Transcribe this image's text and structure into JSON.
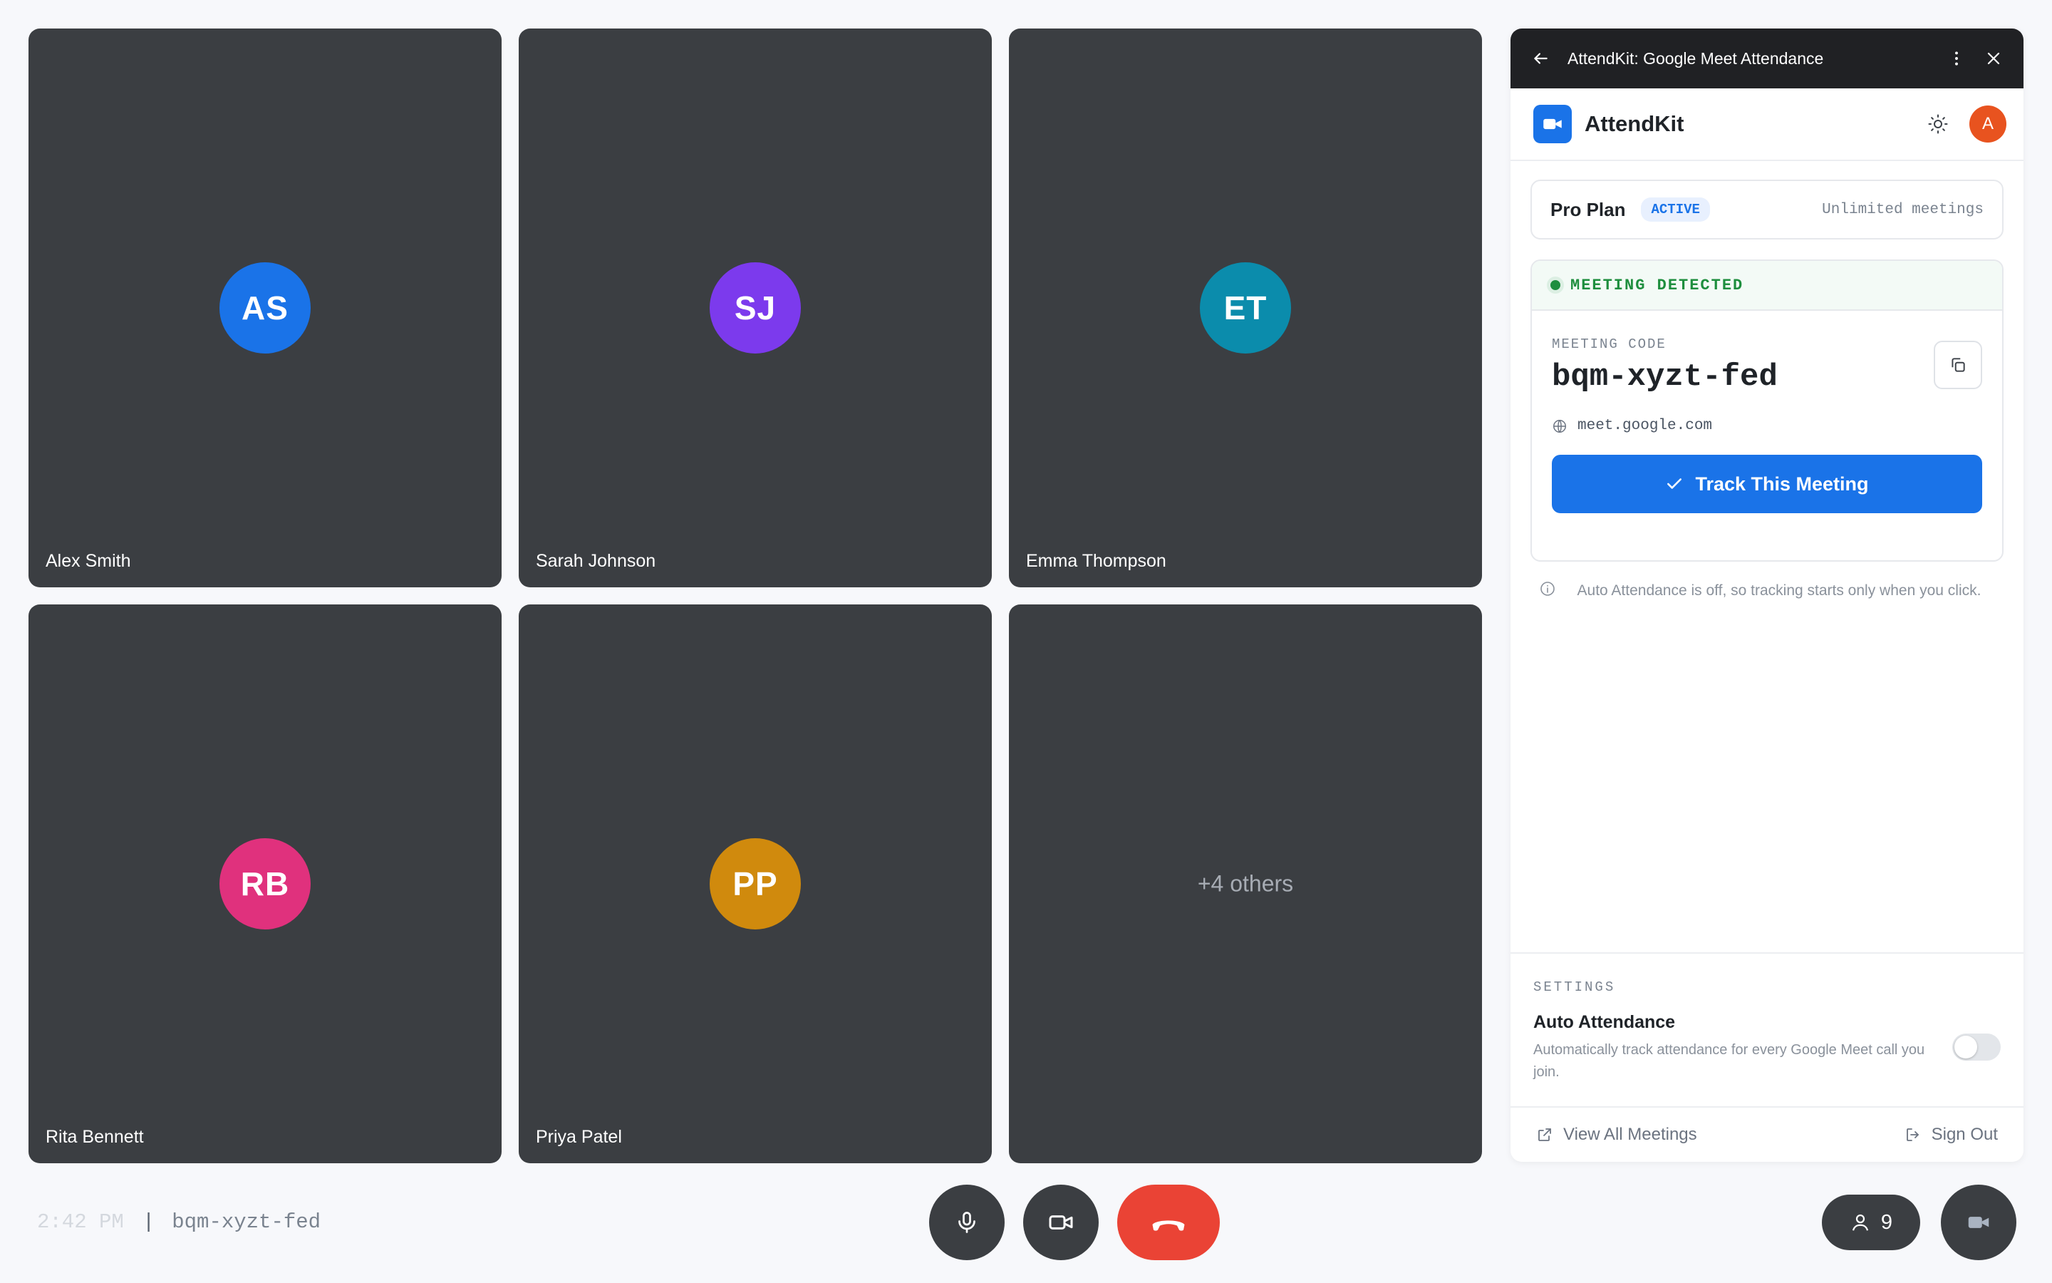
{
  "participants": [
    {
      "initials": "AS",
      "name": "Alex Smith",
      "color": "#1a73e8"
    },
    {
      "initials": "SJ",
      "name": "Sarah Johnson",
      "color": "#7c3aed"
    },
    {
      "initials": "ET",
      "name": "Emma Thompson",
      "color": "#0b8cac"
    },
    {
      "initials": "RB",
      "name": "Rita Bennett",
      "color": "#e0317d"
    },
    {
      "initials": "PP",
      "name": "Priya Patel",
      "color": "#d08a0d"
    }
  ],
  "others_tile": "+4 others",
  "bottom_bar": {
    "time": "2:42 PM",
    "separator": "|",
    "meeting_code": "bqm-xyzt-fed",
    "participant_count": "9"
  },
  "panel": {
    "title": "AttendKit: Google Meet Attendance",
    "brand": "AttendKit",
    "user_initial": "A",
    "plan": {
      "name": "Pro Plan",
      "badge": "ACTIVE",
      "detail": "Unlimited meetings"
    },
    "meeting": {
      "status": "MEETING DETECTED",
      "code_label": "MEETING CODE",
      "code": "bqm-xyzt-fed",
      "domain": "meet.google.com",
      "track_button": "Track This Meeting"
    },
    "note": "Auto Attendance is off, so tracking starts only when you click.",
    "settings": {
      "label": "SETTINGS",
      "auto_title": "Auto Attendance",
      "auto_desc": "Automatically track attendance for every Google Meet call you join.",
      "auto_enabled": false
    },
    "footer": {
      "view_all": "View All Meetings",
      "sign_out": "Sign Out"
    }
  },
  "colors": {
    "accent": "#1a73e8",
    "end_call": "#ea4335",
    "tile_bg": "#3b3e42",
    "success": "#1e8e3e"
  }
}
